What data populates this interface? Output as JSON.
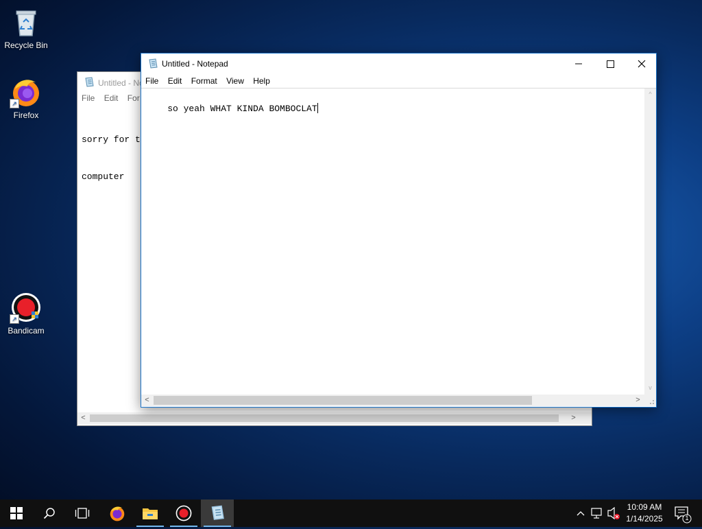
{
  "desktop": {
    "icons": [
      {
        "label": "Recycle Bin"
      },
      {
        "label": "Firefox"
      },
      {
        "label": "Bandicam"
      }
    ]
  },
  "back_window": {
    "title": "Untitled - Notepad",
    "title_visible": "Untitled - No",
    "menu": [
      "File",
      "Edit",
      "Format"
    ],
    "menu_visible": [
      "File",
      "Edit",
      "For"
    ],
    "text_line1": "sorry for t",
    "text_line2": "computer"
  },
  "front_window": {
    "title": "Untitled - Notepad",
    "menu": {
      "file": "File",
      "edit": "Edit",
      "format": "Format",
      "view": "View",
      "help": "Help"
    },
    "text": "so yeah WHAT KINDA BOMBOCLAT"
  },
  "taskbar": {
    "time": "10:09 AM",
    "date": "1/14/2025",
    "notification_count": "1",
    "accent_color": "#76b9ed"
  }
}
